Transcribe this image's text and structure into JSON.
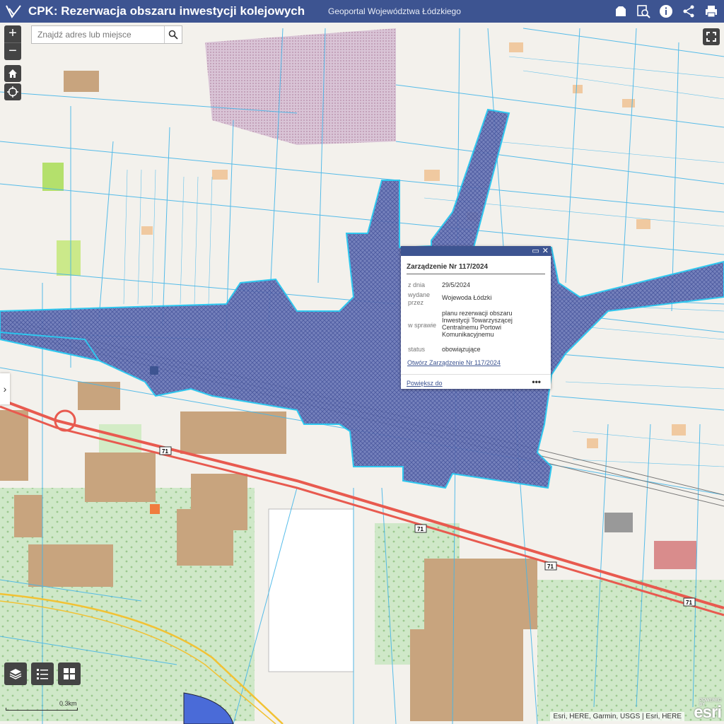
{
  "header": {
    "title": "CPK: Rezerwacja obszaru inwestycji kolejowych",
    "portal": "Geoportal Województwa Łódzkiego",
    "icons": [
      "basemap-icon",
      "search-layer-icon",
      "info-icon",
      "share-icon",
      "print-icon"
    ]
  },
  "search": {
    "placeholder": "Znajdź adres lub miejsce"
  },
  "zoom": {
    "in": "+",
    "out": "−"
  },
  "popup": {
    "title": "Zarządzenie Nr 117/2024",
    "attributes": [
      {
        "key": "z dnia",
        "value": "29/5/2024"
      },
      {
        "key": "wydane przez",
        "value": "Wojewoda Łódzki"
      },
      {
        "key": "w sprawie",
        "value": "planu rezerwacji obszaru Inwestycji Towarzyszącej Centralnemu Portowi Komunikacyjnemu"
      },
      {
        "key": "status",
        "value": "obowiązujące"
      }
    ],
    "link": "Otwórz Zarządzenie Nr 117/2024",
    "zoom_to": "Powiększ do",
    "more": "•••"
  },
  "road_label": "71",
  "scale": {
    "label": "0.3km"
  },
  "attribution": "Esri, HERE, Garmin, USGS | Esri, HERE",
  "esri": {
    "powered_by": "POWERED BY",
    "logo": "esri"
  },
  "colors": {
    "header": "#3d5491",
    "reservation_fill": "#5a6fb5",
    "parcel_lines": "#3db3e6",
    "road": "#e85a4f",
    "buildings": "#c8a47e"
  }
}
